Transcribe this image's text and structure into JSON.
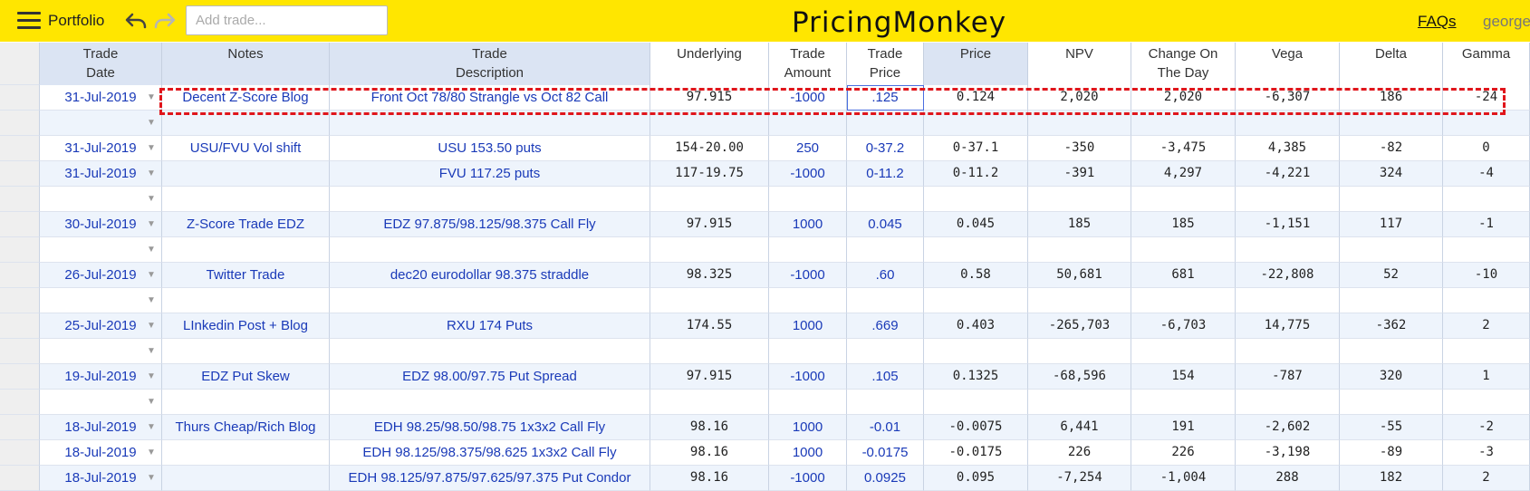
{
  "topbar": {
    "menu_icon": "hamburger-menu-icon",
    "portfolio_label": "Portfolio",
    "undo_icon": "undo-icon",
    "redo_icon": "redo-icon",
    "add_trade_placeholder": "Add trade...",
    "brand": "PricingMonkey",
    "faqs_label": "FAQs",
    "user": "george"
  },
  "colors": {
    "topbar": "#ffe600",
    "header_bg": "#dbe4f3",
    "row_alt": "#eef4fc",
    "link_text": "#1a3ab8",
    "highlight_border": "#e0151b"
  },
  "columns": [
    "Trade\nDate",
    "Notes",
    "Trade\nDescription",
    "Underlying",
    "Trade\nAmount",
    "Trade\nPrice",
    "Price",
    "NPV",
    "Change On\nThe Day",
    "Vega",
    "Delta",
    "Gamma"
  ],
  "rows": [
    {
      "date": "31-Jul-2019",
      "notes": "Decent Z-Score Blog",
      "desc": "Front Oct 78/80 Strangle vs Oct 82 Call",
      "underlying": "97.915",
      "amount": "-1000",
      "tprice": ".125",
      "price": "0.124",
      "npv": "2,020",
      "change": "2,020",
      "vega": "-6,307",
      "delta": "186",
      "gamma": "-24"
    },
    {
      "date": "",
      "notes": "",
      "desc": "",
      "underlying": "",
      "amount": "",
      "tprice": "",
      "price": "",
      "npv": "",
      "change": "",
      "vega": "",
      "delta": "",
      "gamma": ""
    },
    {
      "date": "31-Jul-2019",
      "notes": "USU/FVU Vol shift",
      "desc": "USU 153.50 puts",
      "underlying": "154-20.00",
      "amount": "250",
      "tprice": "0-37.2",
      "price": "0-37.1",
      "npv": "-350",
      "change": "-3,475",
      "vega": "4,385",
      "delta": "-82",
      "gamma": "0"
    },
    {
      "date": "31-Jul-2019",
      "notes": "",
      "desc": "FVU 117.25 puts",
      "underlying": "117-19.75",
      "amount": "-1000",
      "tprice": "0-11.2",
      "price": "0-11.2",
      "npv": "-391",
      "change": "4,297",
      "vega": "-4,221",
      "delta": "324",
      "gamma": "-4"
    },
    {
      "date": "",
      "notes": "",
      "desc": "",
      "underlying": "",
      "amount": "",
      "tprice": "",
      "price": "",
      "npv": "",
      "change": "",
      "vega": "",
      "delta": "",
      "gamma": ""
    },
    {
      "date": "30-Jul-2019",
      "notes": "Z-Score Trade EDZ",
      "desc": "EDZ 97.875/98.125/98.375 Call Fly",
      "underlying": "97.915",
      "amount": "1000",
      "tprice": "0.045",
      "price": "0.045",
      "npv": "185",
      "change": "185",
      "vega": "-1,151",
      "delta": "117",
      "gamma": "-1"
    },
    {
      "date": "",
      "notes": "",
      "desc": "",
      "underlying": "",
      "amount": "",
      "tprice": "",
      "price": "",
      "npv": "",
      "change": "",
      "vega": "",
      "delta": "",
      "gamma": ""
    },
    {
      "date": "26-Jul-2019",
      "notes": "Twitter Trade",
      "desc": "dec20 eurodollar 98.375 straddle",
      "underlying": "98.325",
      "amount": "-1000",
      "tprice": ".60",
      "price": "0.58",
      "npv": "50,681",
      "change": "681",
      "vega": "-22,808",
      "delta": "52",
      "gamma": "-10"
    },
    {
      "date": "",
      "notes": "",
      "desc": "",
      "underlying": "",
      "amount": "",
      "tprice": "",
      "price": "",
      "npv": "",
      "change": "",
      "vega": "",
      "delta": "",
      "gamma": ""
    },
    {
      "date": "25-Jul-2019",
      "notes": "LInkedin Post + Blog",
      "desc": "RXU 174 Puts",
      "underlying": "174.55",
      "amount": "1000",
      "tprice": ".669",
      "price": "0.403",
      "npv": "-265,703",
      "change": "-6,703",
      "vega": "14,775",
      "delta": "-362",
      "gamma": "2"
    },
    {
      "date": "",
      "notes": "",
      "desc": "",
      "underlying": "",
      "amount": "",
      "tprice": "",
      "price": "",
      "npv": "",
      "change": "",
      "vega": "",
      "delta": "",
      "gamma": ""
    },
    {
      "date": "19-Jul-2019",
      "notes": "EDZ Put Skew",
      "desc": "EDZ 98.00/97.75 Put Spread",
      "underlying": "97.915",
      "amount": "-1000",
      "tprice": ".105",
      "price": "0.1325",
      "npv": "-68,596",
      "change": "154",
      "vega": "-787",
      "delta": "320",
      "gamma": "1"
    },
    {
      "date": "",
      "notes": "",
      "desc": "",
      "underlying": "",
      "amount": "",
      "tprice": "",
      "price": "",
      "npv": "",
      "change": "",
      "vega": "",
      "delta": "",
      "gamma": ""
    },
    {
      "date": "18-Jul-2019",
      "notes": "Thurs Cheap/Rich Blog",
      "desc": "EDH 98.25/98.50/98.75 1x3x2 Call Fly",
      "underlying": "98.16",
      "amount": "1000",
      "tprice": "-0.01",
      "price": "-0.0075",
      "npv": "6,441",
      "change": "191",
      "vega": "-2,602",
      "delta": "-55",
      "gamma": "-2"
    },
    {
      "date": "18-Jul-2019",
      "notes": "",
      "desc": "EDH 98.125/98.375/98.625 1x3x2 Call Fly",
      "underlying": "98.16",
      "amount": "1000",
      "tprice": "-0.0175",
      "price": "-0.0175",
      "npv": "226",
      "change": "226",
      "vega": "-3,198",
      "delta": "-89",
      "gamma": "-3"
    },
    {
      "date": "18-Jul-2019",
      "notes": "",
      "desc": "EDH 98.125/97.875/97.625/97.375 Put Condor",
      "underlying": "98.16",
      "amount": "-1000",
      "tprice": "0.0925",
      "price": "0.095",
      "npv": "-7,254",
      "change": "-1,004",
      "vega": "288",
      "delta": "182",
      "gamma": "2"
    }
  ]
}
